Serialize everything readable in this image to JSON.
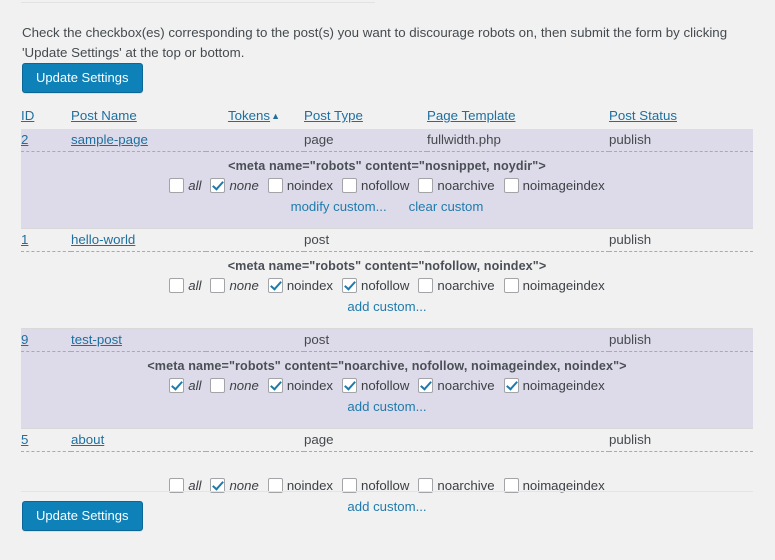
{
  "intro_text": "Check the checkbox(es) corresponding to the post(s) you want to discourage robots on, then submit the form by clicking 'Update Settings' at the top or bottom.",
  "buttons": {
    "update_top": "Update Settings",
    "update_bottom": "Update Settings"
  },
  "table": {
    "headers": {
      "id": "ID",
      "post_name": "Post Name",
      "tokens": "Tokens",
      "tokens_sort": "▲",
      "post_type": "Post Type",
      "page_template": "Page Template",
      "post_status": "Post Status"
    },
    "rows": [
      {
        "id": "2",
        "post_name": "sample-page",
        "tokens": "",
        "post_type": "page",
        "page_template": "fullwidth.php",
        "post_status": "publish",
        "meta": "<meta name=\"robots\" content=\"nosnippet, noydir\">",
        "has_meta": true,
        "checkboxes": [
          {
            "name": "all",
            "label": "all",
            "checked": false,
            "italic": true
          },
          {
            "name": "none",
            "label": "none",
            "checked": true,
            "italic": true
          },
          {
            "name": "noindex",
            "label": "noindex",
            "checked": false,
            "italic": false
          },
          {
            "name": "nofollow",
            "label": "nofollow",
            "checked": false,
            "italic": false
          },
          {
            "name": "noarchive",
            "label": "noarchive",
            "checked": false,
            "italic": false
          },
          {
            "name": "noimageindex",
            "label": "noimageindex",
            "checked": false,
            "italic": false
          }
        ],
        "links": [
          {
            "name": "modify-custom",
            "label": "modify custom..."
          },
          {
            "name": "clear-custom",
            "label": "clear custom"
          }
        ]
      },
      {
        "id": "1",
        "post_name": "hello-world",
        "tokens": "",
        "post_type": "post",
        "page_template": "",
        "post_status": "publish",
        "meta": "<meta name=\"robots\" content=\"nofollow, noindex\">",
        "has_meta": true,
        "checkboxes": [
          {
            "name": "all",
            "label": "all",
            "checked": false,
            "italic": true
          },
          {
            "name": "none",
            "label": "none",
            "checked": false,
            "italic": true
          },
          {
            "name": "noindex",
            "label": "noindex",
            "checked": true,
            "italic": false
          },
          {
            "name": "nofollow",
            "label": "nofollow",
            "checked": true,
            "italic": false
          },
          {
            "name": "noarchive",
            "label": "noarchive",
            "checked": false,
            "italic": false
          },
          {
            "name": "noimageindex",
            "label": "noimageindex",
            "checked": false,
            "italic": false
          }
        ],
        "links": [
          {
            "name": "add-custom",
            "label": "add custom..."
          }
        ]
      },
      {
        "id": "9",
        "post_name": "test-post",
        "tokens": "",
        "post_type": "post",
        "page_template": "",
        "post_status": "publish",
        "meta": "<meta name=\"robots\" content=\"noarchive, nofollow, noimageindex, noindex\">",
        "has_meta": true,
        "checkboxes": [
          {
            "name": "all",
            "label": "all",
            "checked": true,
            "italic": true
          },
          {
            "name": "none",
            "label": "none",
            "checked": false,
            "italic": true
          },
          {
            "name": "noindex",
            "label": "noindex",
            "checked": true,
            "italic": false
          },
          {
            "name": "nofollow",
            "label": "nofollow",
            "checked": true,
            "italic": false
          },
          {
            "name": "noarchive",
            "label": "noarchive",
            "checked": true,
            "italic": false
          },
          {
            "name": "noimageindex",
            "label": "noimageindex",
            "checked": true,
            "italic": false
          }
        ],
        "links": [
          {
            "name": "add-custom",
            "label": "add custom..."
          }
        ]
      },
      {
        "id": "5",
        "post_name": "about",
        "tokens": "",
        "post_type": "page",
        "page_template": "",
        "post_status": "publish",
        "meta": "",
        "has_meta": false,
        "checkboxes": [
          {
            "name": "all",
            "label": "all",
            "checked": false,
            "italic": true
          },
          {
            "name": "none",
            "label": "none",
            "checked": true,
            "italic": true
          },
          {
            "name": "noindex",
            "label": "noindex",
            "checked": false,
            "italic": false
          },
          {
            "name": "nofollow",
            "label": "nofollow",
            "checked": false,
            "italic": false
          },
          {
            "name": "noarchive",
            "label": "noarchive",
            "checked": false,
            "italic": false
          },
          {
            "name": "noimageindex",
            "label": "noimageindex",
            "checked": false,
            "italic": false
          }
        ],
        "links": [
          {
            "name": "add-custom",
            "label": "add custom..."
          }
        ]
      }
    ]
  },
  "colors": {
    "accent": "#0d81b8",
    "link": "#1f6f9e",
    "alt_row_bg": "#dddbe9",
    "page_bg": "#f1f1f1"
  }
}
